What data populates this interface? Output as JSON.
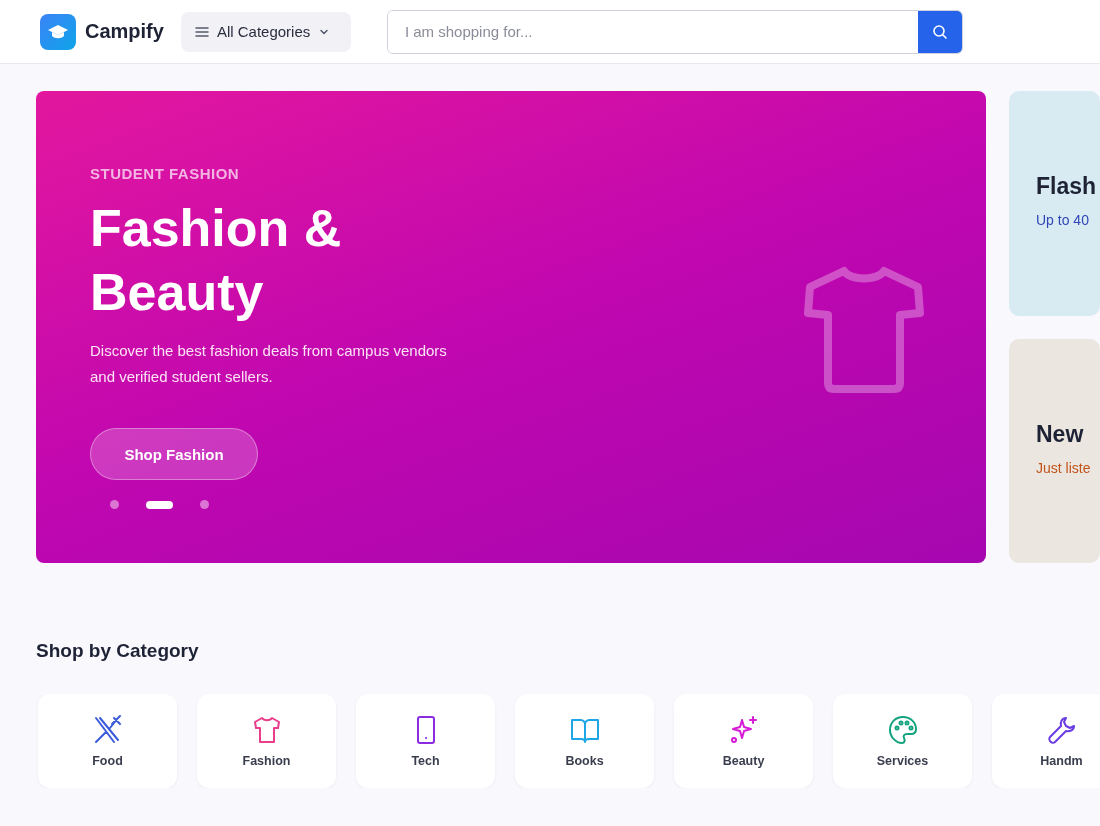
{
  "header": {
    "logo": "Campify",
    "categories_button": "All Categories",
    "search": {
      "placeholder": "I am shopping for..."
    }
  },
  "hero": {
    "eyebrow": "STUDENT FASHION",
    "title": "Fashion & Beauty",
    "description": "Discover the best fashion deals from campus vendors and verified student sellers.",
    "button": "Shop Fashion",
    "dots": [
      {
        "selected": false
      },
      {
        "selected": true
      },
      {
        "selected": false
      }
    ]
  },
  "side_cards": [
    {
      "kind": "flash",
      "title": "Flash",
      "subtitle": "Up to 40"
    },
    {
      "kind": "new",
      "title": "New",
      "subtitle": "Just liste"
    }
  ],
  "categories": {
    "title": "Shop by Category",
    "items": [
      {
        "label": "Food",
        "color": "#3b5bdb"
      },
      {
        "label": "Fashion",
        "color": "#e83e8c"
      },
      {
        "label": "Tech",
        "color": "#8b2be2"
      },
      {
        "label": "Books",
        "color": "#1ea7e6"
      },
      {
        "label": "Beauty",
        "color": "#d61ad6"
      },
      {
        "label": "Services",
        "color": "#14a37f"
      },
      {
        "label": "Handm",
        "color": "#6b3be2"
      }
    ]
  }
}
